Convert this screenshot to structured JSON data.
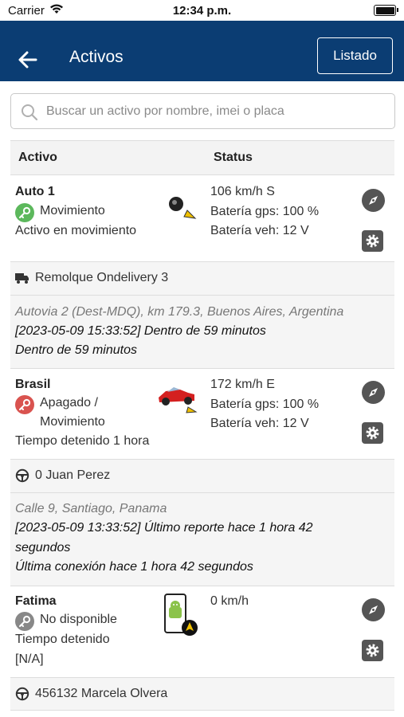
{
  "status_bar": {
    "carrier": "Carrier",
    "time": "12:34 p.m."
  },
  "header": {
    "title": "Activos",
    "list_button": "Listado"
  },
  "search": {
    "placeholder": "Buscar un activo por nombre, imei o placa"
  },
  "table": {
    "col_asset": "Activo",
    "col_status": "Status"
  },
  "assets": [
    {
      "name": "Auto 1",
      "state": "Movimiento",
      "desc": "Activo en movimiento",
      "speed": "106 km/h S",
      "gps_battery": "Batería gps: 100 %",
      "veh_battery": "Batería veh: 12 V",
      "key_color": "#5cb85c",
      "driver": "Remolque Ondelivery 3",
      "driver_icon": "truck-icon",
      "address": "Autovia 2 (Dest-MDQ), km 179.3, Buenos Aires, Argentina",
      "report": "[2023-05-09 15:33:52] Dentro de 59 minutos",
      "connection": "Dentro de 59 minutos"
    },
    {
      "name": "Brasil",
      "state_line1": "Apagado /",
      "state_line2": "Movimiento",
      "desc": "Tiempo detenido 1 hora",
      "speed": "172 km/h E",
      "gps_battery": "Batería gps: 100 %",
      "veh_battery": "Batería veh: 12 V",
      "key_color": "#d9534f",
      "driver": "0 Juan Perez",
      "driver_icon": "steering-wheel-icon",
      "address": "Calle 9, Santiago, Panama",
      "report_line1": "[2023-05-09 13:33:52] Último reporte hace 1 hora 42",
      "report_line2": "segundos",
      "connection": "Última conexión hace 1 hora 42 segundos"
    },
    {
      "name": "Fatima",
      "state": "No disponible",
      "desc": "Tiempo detenido",
      "desc2": "[N/A]",
      "speed": "0 km/h",
      "key_color": "#888888",
      "driver": "456132 Marcela Olvera",
      "driver_icon": "steering-wheel-icon"
    }
  ],
  "colors": {
    "navbar": "#0b3d73",
    "button_gray": "#555555"
  }
}
